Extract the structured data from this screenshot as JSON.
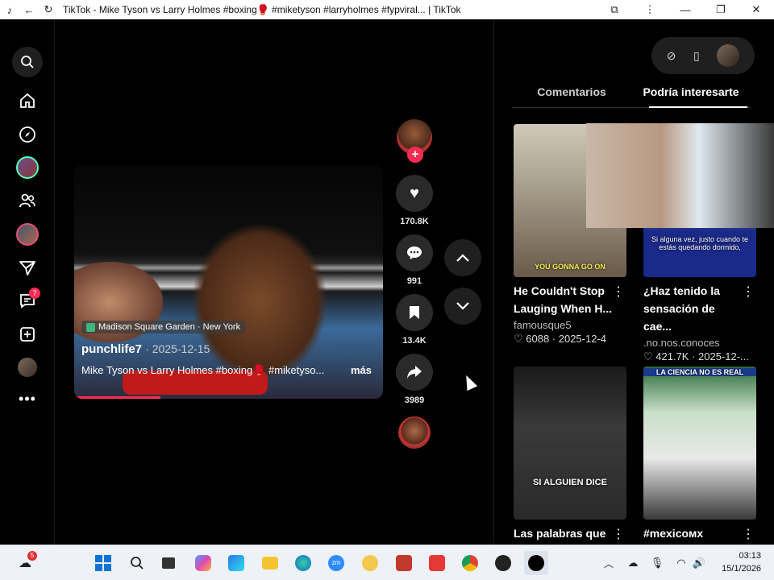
{
  "window": {
    "title": "TikTok - Mike Tyson vs Larry Holmes #boxing🥊 #miketyson #larryholmes #fypviral... | TikTok"
  },
  "leftnav": {
    "notifications_badge": "7"
  },
  "video": {
    "location": "Madison Square Garden · New York",
    "author": "punchlife7",
    "date": "· 2025-12-15",
    "description": "Mike Tyson vs Larry Holmes #boxing🥊 #miketyso...",
    "more_label": "más",
    "progress_fraction": 0.28
  },
  "actions": {
    "likes": "170.8K",
    "comments": "991",
    "saves": "13.4K",
    "shares": "3989"
  },
  "panel": {
    "tabs": [
      {
        "label": "Comentarios"
      },
      {
        "label": "Podría interesarte"
      }
    ],
    "active_tab": "Podría interesarte",
    "cards": [
      {
        "title": "He Couldn't Stop Lauging When H...",
        "author": "famousque5",
        "stats": "♡ 6088 · 2025-12-4",
        "caption": "YOU GONNA GO ON"
      },
      {
        "title": "¿Haz tenido la sensación de cae...",
        "author": ".no.nos.conoces",
        "stats": "♡ 421.7K · 2025-12-...",
        "caption": "Si alguna vez, justo cuando te estás quedando dormido,"
      },
      {
        "title": "Las palabras que",
        "author": "",
        "stats": "",
        "caption": "SI ALGUIEN DICE"
      },
      {
        "title": "#mexicoᴍx",
        "author": "",
        "stats": "",
        "caption": "LA CIENCIA NO ES REAL"
      }
    ]
  },
  "taskbar": {
    "weather_badge": "5",
    "time": "03:13",
    "date": "15/1/2026"
  },
  "colors": {
    "accent": "#fe2c55",
    "background": "#000000"
  }
}
